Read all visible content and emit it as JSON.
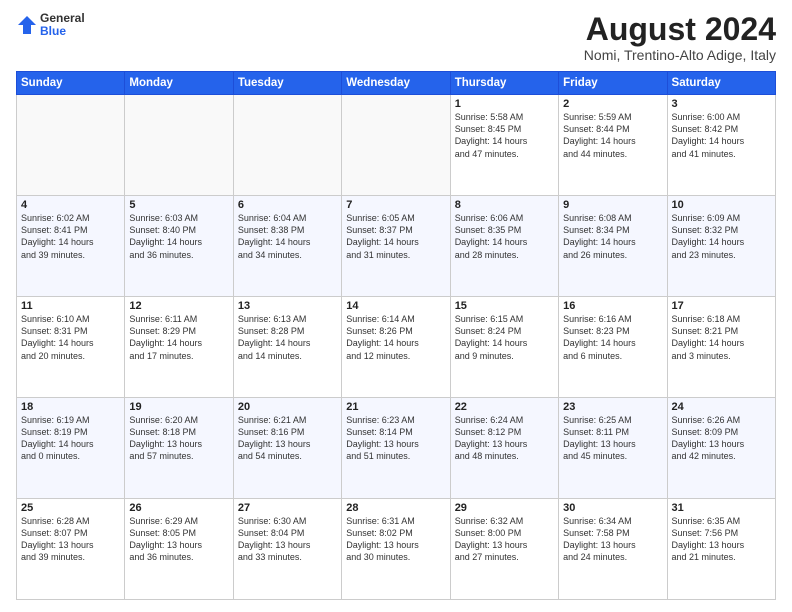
{
  "header": {
    "logo": {
      "general": "General",
      "blue": "Blue"
    },
    "title": "August 2024",
    "subtitle": "Nomi, Trentino-Alto Adige, Italy"
  },
  "calendar": {
    "days_of_week": [
      "Sunday",
      "Monday",
      "Tuesday",
      "Wednesday",
      "Thursday",
      "Friday",
      "Saturday"
    ],
    "weeks": [
      [
        {
          "day": "",
          "info": ""
        },
        {
          "day": "",
          "info": ""
        },
        {
          "day": "",
          "info": ""
        },
        {
          "day": "",
          "info": ""
        },
        {
          "day": "1",
          "info": "Sunrise: 5:58 AM\nSunset: 8:45 PM\nDaylight: 14 hours\nand 47 minutes."
        },
        {
          "day": "2",
          "info": "Sunrise: 5:59 AM\nSunset: 8:44 PM\nDaylight: 14 hours\nand 44 minutes."
        },
        {
          "day": "3",
          "info": "Sunrise: 6:00 AM\nSunset: 8:42 PM\nDaylight: 14 hours\nand 41 minutes."
        }
      ],
      [
        {
          "day": "4",
          "info": "Sunrise: 6:02 AM\nSunset: 8:41 PM\nDaylight: 14 hours\nand 39 minutes."
        },
        {
          "day": "5",
          "info": "Sunrise: 6:03 AM\nSunset: 8:40 PM\nDaylight: 14 hours\nand 36 minutes."
        },
        {
          "day": "6",
          "info": "Sunrise: 6:04 AM\nSunset: 8:38 PM\nDaylight: 14 hours\nand 34 minutes."
        },
        {
          "day": "7",
          "info": "Sunrise: 6:05 AM\nSunset: 8:37 PM\nDaylight: 14 hours\nand 31 minutes."
        },
        {
          "day": "8",
          "info": "Sunrise: 6:06 AM\nSunset: 8:35 PM\nDaylight: 14 hours\nand 28 minutes."
        },
        {
          "day": "9",
          "info": "Sunrise: 6:08 AM\nSunset: 8:34 PM\nDaylight: 14 hours\nand 26 minutes."
        },
        {
          "day": "10",
          "info": "Sunrise: 6:09 AM\nSunset: 8:32 PM\nDaylight: 14 hours\nand 23 minutes."
        }
      ],
      [
        {
          "day": "11",
          "info": "Sunrise: 6:10 AM\nSunset: 8:31 PM\nDaylight: 14 hours\nand 20 minutes."
        },
        {
          "day": "12",
          "info": "Sunrise: 6:11 AM\nSunset: 8:29 PM\nDaylight: 14 hours\nand 17 minutes."
        },
        {
          "day": "13",
          "info": "Sunrise: 6:13 AM\nSunset: 8:28 PM\nDaylight: 14 hours\nand 14 minutes."
        },
        {
          "day": "14",
          "info": "Sunrise: 6:14 AM\nSunset: 8:26 PM\nDaylight: 14 hours\nand 12 minutes."
        },
        {
          "day": "15",
          "info": "Sunrise: 6:15 AM\nSunset: 8:24 PM\nDaylight: 14 hours\nand 9 minutes."
        },
        {
          "day": "16",
          "info": "Sunrise: 6:16 AM\nSunset: 8:23 PM\nDaylight: 14 hours\nand 6 minutes."
        },
        {
          "day": "17",
          "info": "Sunrise: 6:18 AM\nSunset: 8:21 PM\nDaylight: 14 hours\nand 3 minutes."
        }
      ],
      [
        {
          "day": "18",
          "info": "Sunrise: 6:19 AM\nSunset: 8:19 PM\nDaylight: 14 hours\nand 0 minutes."
        },
        {
          "day": "19",
          "info": "Sunrise: 6:20 AM\nSunset: 8:18 PM\nDaylight: 13 hours\nand 57 minutes."
        },
        {
          "day": "20",
          "info": "Sunrise: 6:21 AM\nSunset: 8:16 PM\nDaylight: 13 hours\nand 54 minutes."
        },
        {
          "day": "21",
          "info": "Sunrise: 6:23 AM\nSunset: 8:14 PM\nDaylight: 13 hours\nand 51 minutes."
        },
        {
          "day": "22",
          "info": "Sunrise: 6:24 AM\nSunset: 8:12 PM\nDaylight: 13 hours\nand 48 minutes."
        },
        {
          "day": "23",
          "info": "Sunrise: 6:25 AM\nSunset: 8:11 PM\nDaylight: 13 hours\nand 45 minutes."
        },
        {
          "day": "24",
          "info": "Sunrise: 6:26 AM\nSunset: 8:09 PM\nDaylight: 13 hours\nand 42 minutes."
        }
      ],
      [
        {
          "day": "25",
          "info": "Sunrise: 6:28 AM\nSunset: 8:07 PM\nDaylight: 13 hours\nand 39 minutes."
        },
        {
          "day": "26",
          "info": "Sunrise: 6:29 AM\nSunset: 8:05 PM\nDaylight: 13 hours\nand 36 minutes."
        },
        {
          "day": "27",
          "info": "Sunrise: 6:30 AM\nSunset: 8:04 PM\nDaylight: 13 hours\nand 33 minutes."
        },
        {
          "day": "28",
          "info": "Sunrise: 6:31 AM\nSunset: 8:02 PM\nDaylight: 13 hours\nand 30 minutes."
        },
        {
          "day": "29",
          "info": "Sunrise: 6:32 AM\nSunset: 8:00 PM\nDaylight: 13 hours\nand 27 minutes."
        },
        {
          "day": "30",
          "info": "Sunrise: 6:34 AM\nSunset: 7:58 PM\nDaylight: 13 hours\nand 24 minutes."
        },
        {
          "day": "31",
          "info": "Sunrise: 6:35 AM\nSunset: 7:56 PM\nDaylight: 13 hours\nand 21 minutes."
        }
      ]
    ]
  }
}
